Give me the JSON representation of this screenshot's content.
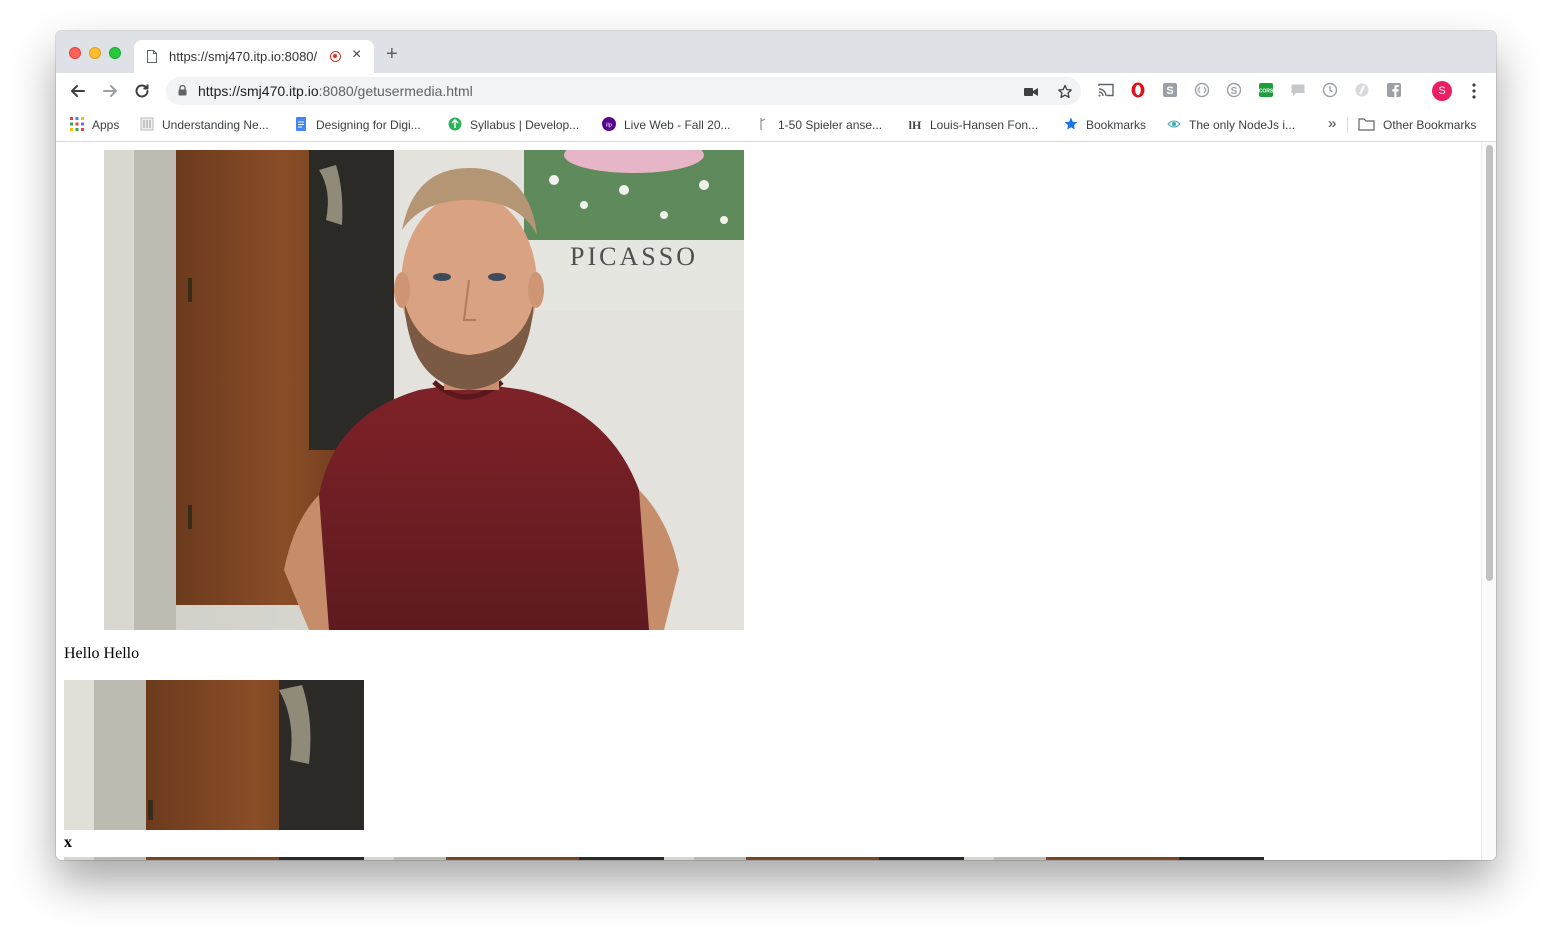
{
  "browser": {
    "tab": {
      "title": "https://smj470.itp.io:8080/",
      "close": "×"
    },
    "new_tab": "+",
    "url": {
      "scheme_host": "https://smj470.itp.io",
      "rest": ":8080/getusermedia.html"
    },
    "profile_initial": "S"
  },
  "bookmarks": [
    {
      "label": "Apps",
      "icon": "apps-grid-icon"
    },
    {
      "label": "Understanding Ne...",
      "icon": "bookmark-favicon"
    },
    {
      "label": "Designing for Digi...",
      "icon": "google-docs-icon"
    },
    {
      "label": "Syllabus | Develop...",
      "icon": "bookmark-favicon"
    },
    {
      "label": "Live Web - Fall 20...",
      "icon": "itp-icon"
    },
    {
      "label": "1-50 Spieler anse...",
      "icon": "bookmark-favicon"
    },
    {
      "label": "Louis-Hansen Fon...",
      "icon": "lh-icon"
    },
    {
      "label": "Bookmarks",
      "icon": "star-icon"
    },
    {
      "label": "The only NodeJs i...",
      "icon": "eye-icon"
    }
  ],
  "bookmarks_overflow": "»",
  "other_bookmarks": "Other Bookmarks",
  "page": {
    "poster_text": "PICASSO",
    "text": "Hello Hello",
    "x_label": "x"
  }
}
